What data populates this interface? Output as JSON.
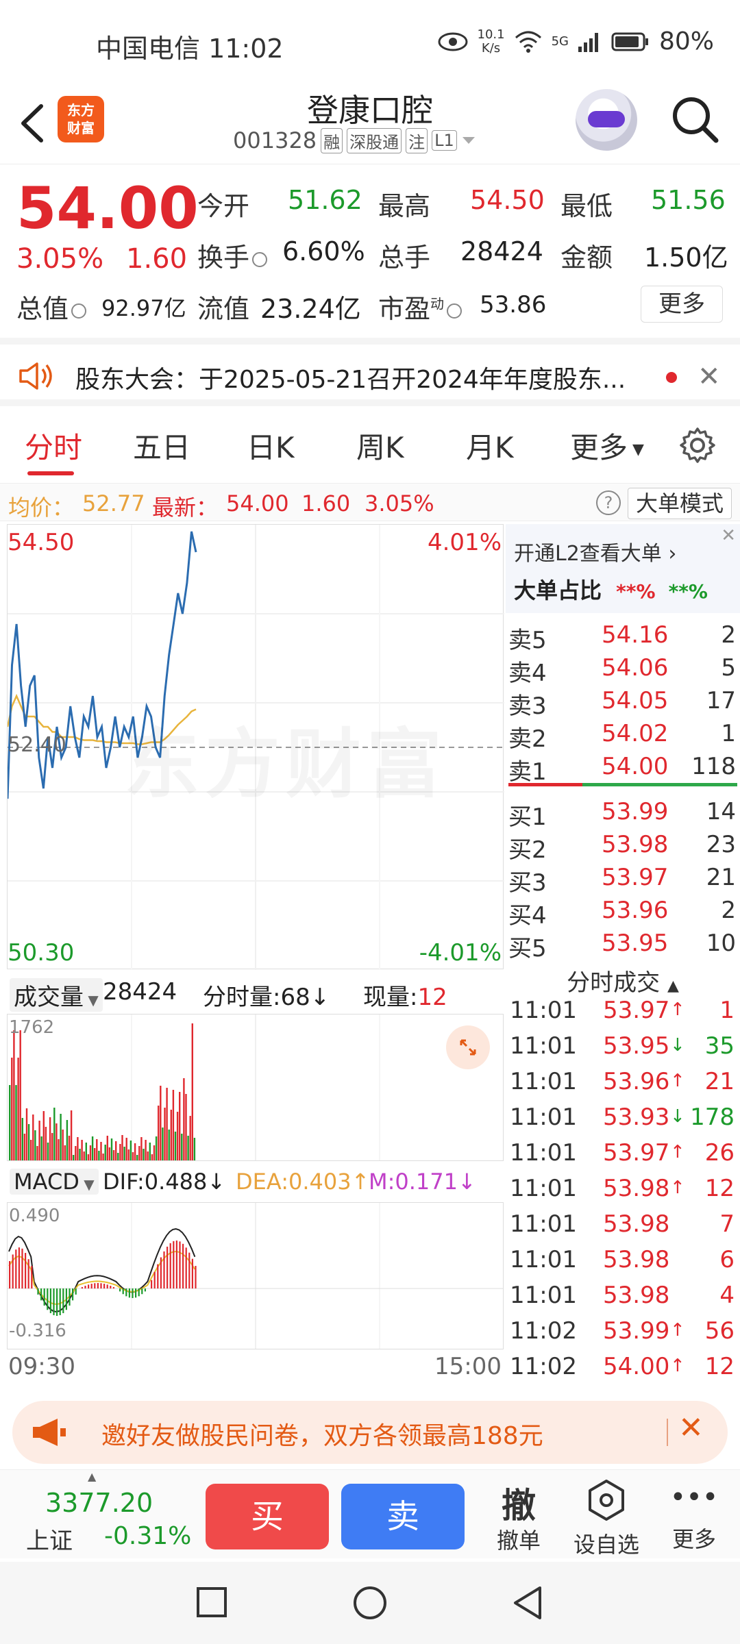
{
  "status_bar": {
    "carrier_time": "中国电信 11:02",
    "net_speed_value": "10.1",
    "net_speed_unit": "K/s",
    "signal": "5G",
    "battery": "80%"
  },
  "header": {
    "brand_line1": "东方",
    "brand_line2": "财富",
    "stock_name": "登康口腔",
    "stock_code": "001328",
    "tags": [
      "融",
      "深股通",
      "注",
      "L1"
    ]
  },
  "quote": {
    "price": "54.00",
    "change_pct": "3.05%",
    "change_amt": "1.60",
    "open_label": "今开",
    "open": "51.62",
    "high_label": "最高",
    "high": "54.50",
    "low_label": "最低",
    "low": "51.56",
    "turnover_label": "换手",
    "turnover": "6.60%",
    "vol_label": "总手",
    "vol": "28424",
    "amount_label": "金额",
    "amount": "1.50亿",
    "mktcap_label": "总值",
    "mktcap": "92.97亿",
    "float_label": "流值",
    "float": "23.24亿",
    "pe_label": "市盈",
    "pe_sup": "动",
    "pe": "53.86",
    "more": "更多"
  },
  "notice": {
    "text": "股东大会：于2025-05-21召开2024年年度股东..."
  },
  "tabs": [
    "分时",
    "五日",
    "日K",
    "周K",
    "月K",
    "更多"
  ],
  "avg_line": {
    "avg_label": "均价：",
    "avg": "52.77",
    "latest_label": "最新：",
    "latest": "54.00",
    "chg": "1.60",
    "pct": "3.05%",
    "big_mode": "大单模式"
  },
  "chart": {
    "top_price": "54.50",
    "top_pct": "4.01%",
    "mid_price": "52.40",
    "bot_price": "50.30",
    "bot_pct": "-4.01%",
    "watermark": "东方财富"
  },
  "chart_data": {
    "type": "line",
    "ylim": [
      50.3,
      54.5
    ],
    "preclose": 52.4,
    "series": [
      {
        "values": [
          51.9,
          53.2,
          53.6,
          53.0,
          52.6,
          53.0,
          53.1,
          52.3,
          52.0,
          52.5,
          52.2,
          52.6,
          52.3,
          52.4,
          52.8,
          52.5,
          52.3,
          52.7,
          52.6,
          52.9,
          52.5,
          52.6,
          52.2,
          52.4,
          52.7,
          52.4,
          52.6,
          52.5,
          52.7,
          52.3,
          52.5,
          52.8,
          52.7,
          52.4,
          52.3,
          52.9,
          53.3,
          53.6,
          53.9,
          53.7,
          54.0,
          54.5,
          54.3
        ]
      },
      {
        "values": [
          52.6,
          52.8,
          52.9,
          52.8,
          52.7,
          52.7,
          52.7,
          52.65,
          52.6,
          52.6,
          52.55,
          52.55,
          52.5,
          52.5,
          52.5,
          52.5,
          52.48,
          52.47,
          52.47,
          52.47,
          52.46,
          52.46,
          52.45,
          52.45,
          52.45,
          52.44,
          52.44,
          52.44,
          52.44,
          52.43,
          52.43,
          52.44,
          52.45,
          52.45,
          52.45,
          52.48,
          52.52,
          52.57,
          52.62,
          52.66,
          52.7,
          52.75,
          52.77
        ]
      }
    ]
  },
  "order_book": {
    "l2_link": "开通L2查看大单",
    "ratio_label": "大单占比",
    "ratio_red": "**%",
    "ratio_green": "**%",
    "asks": [
      {
        "label": "卖5",
        "price": "54.16",
        "vol": "2"
      },
      {
        "label": "卖4",
        "price": "54.06",
        "vol": "5"
      },
      {
        "label": "卖3",
        "price": "54.05",
        "vol": "17"
      },
      {
        "label": "卖2",
        "price": "54.02",
        "vol": "1"
      },
      {
        "label": "卖1",
        "price": "54.00",
        "vol": "118"
      }
    ],
    "bids": [
      {
        "label": "买1",
        "price": "53.99",
        "vol": "14"
      },
      {
        "label": "买2",
        "price": "53.98",
        "vol": "23"
      },
      {
        "label": "买3",
        "price": "53.97",
        "vol": "21"
      },
      {
        "label": "买4",
        "price": "53.96",
        "vol": "2"
      },
      {
        "label": "买5",
        "price": "53.95",
        "vol": "10"
      }
    ]
  },
  "volume": {
    "label": "成交量",
    "total": "28424",
    "tick_label": "分时量:68↓",
    "now_label": "现量:",
    "now": "12",
    "max": "1762"
  },
  "macd": {
    "label": "MACD",
    "dif": "DIF:0.488↓",
    "dea": "DEA:0.403↑",
    "m": "M:0.171↓",
    "top": "0.490",
    "bottom": "-0.316"
  },
  "time_axis": {
    "start": "09:30",
    "end": "15:00"
  },
  "trades": {
    "title": "分时成交",
    "rows": [
      {
        "time": "11:01",
        "price": "53.97",
        "dir": "↑",
        "vol": "1",
        "color": "#e0282e"
      },
      {
        "time": "11:01",
        "price": "53.95",
        "dir": "↓",
        "vol": "35",
        "color": "#1c9a2b"
      },
      {
        "time": "11:01",
        "price": "53.96",
        "dir": "↑",
        "vol": "21",
        "color": "#e0282e"
      },
      {
        "time": "11:01",
        "price": "53.93",
        "dir": "↓",
        "vol": "178",
        "color": "#1c9a2b"
      },
      {
        "time": "11:01",
        "price": "53.97",
        "dir": "↑",
        "vol": "26",
        "color": "#e0282e"
      },
      {
        "time": "11:01",
        "price": "53.98",
        "dir": "↑",
        "vol": "12",
        "color": "#e0282e"
      },
      {
        "time": "11:01",
        "price": "53.98",
        "dir": "",
        "vol": "7",
        "color": "#e0282e"
      },
      {
        "time": "11:01",
        "price": "53.98",
        "dir": "",
        "vol": "6",
        "color": "#e0282e"
      },
      {
        "time": "11:01",
        "price": "53.98",
        "dir": "",
        "vol": "4",
        "color": "#e0282e"
      },
      {
        "time": "11:02",
        "price": "53.99",
        "dir": "↑",
        "vol": "56",
        "color": "#e0282e"
      },
      {
        "time": "11:02",
        "price": "54.00",
        "dir": "↑",
        "vol": "12",
        "color": "#e0282e"
      }
    ]
  },
  "promo": {
    "text": "邀好友做股民问卷，双方各领最高188元"
  },
  "bottom_bar": {
    "index_value": "3377.20",
    "index_name": "上证",
    "index_pct": "-0.31%",
    "buy": "买",
    "sell": "卖",
    "cancel_icon": "撤",
    "cancel": "撤单",
    "watch": "设自选",
    "more": "更多"
  },
  "colors": {
    "up": "#e0282e",
    "down": "#1c9a2b",
    "price_line": "#2b6cb0",
    "avg_line": "#e8b43c"
  }
}
